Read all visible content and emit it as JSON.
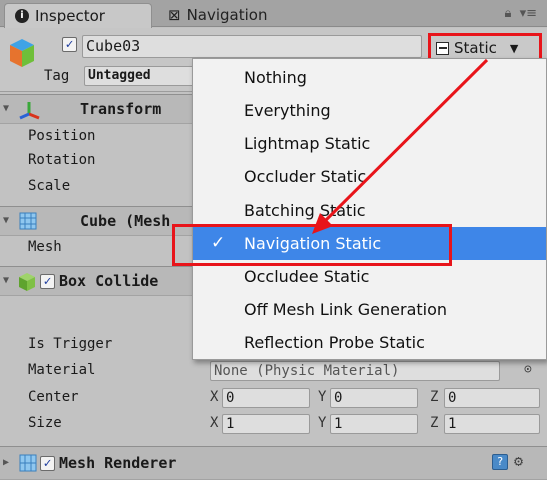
{
  "tabs": {
    "inspector_label": "Inspector",
    "navigation_label": "Navigation",
    "lock_icon": "lock-icon",
    "menu_icon": "panel-menu-icon"
  },
  "object": {
    "name": "Cube03",
    "active": true,
    "tag_label": "Tag",
    "tag_value": "Untagged",
    "static_label": "Static",
    "static_mixed": true
  },
  "transform": {
    "title": "Transform",
    "position_label": "Position",
    "rotation_label": "Rotation",
    "scale_label": "Scale"
  },
  "mesh_filter": {
    "title": "Cube (Mesh",
    "mesh_label": "Mesh"
  },
  "box_collider": {
    "title": "Box Collide",
    "enabled": true,
    "is_trigger_label": "Is Trigger",
    "material_label": "Material",
    "material_value": "None (Physic Material)",
    "center_label": "Center",
    "center": {
      "x": "0",
      "y": "0",
      "z": "0"
    },
    "size_label": "Size",
    "size": {
      "x": "1",
      "y": "1",
      "z": "1"
    },
    "axis_x": "X",
    "axis_y": "Y",
    "axis_z": "Z"
  },
  "mesh_renderer": {
    "title": "Mesh Renderer",
    "enabled": true
  },
  "static_menu": {
    "items": [
      {
        "label": "Nothing",
        "checked": false
      },
      {
        "label": "Everything",
        "checked": false
      },
      {
        "label": "Lightmap Static",
        "checked": false
      },
      {
        "label": "Occluder Static",
        "checked": false
      },
      {
        "label": "Batching Static",
        "checked": false
      },
      {
        "label": "Navigation Static",
        "checked": true
      },
      {
        "label": "Occludee Static",
        "checked": false
      },
      {
        "label": "Off Mesh Link Generation",
        "checked": false
      },
      {
        "label": "Reflection Probe Static",
        "checked": false
      }
    ],
    "check_glyph": "✓"
  },
  "colors": {
    "annotation_red": "#e8141a",
    "selection_blue": "#3e86e8"
  }
}
